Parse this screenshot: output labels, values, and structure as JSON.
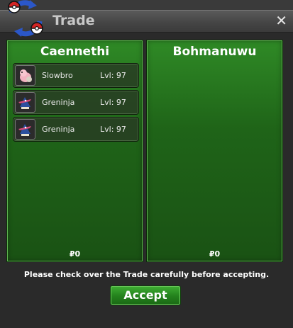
{
  "window": {
    "title": "Trade",
    "close_label": "✕"
  },
  "left_panel": {
    "trainer_name": "Caennethi",
    "pokemon": [
      {
        "name": "Slowbro",
        "level": "Lvl: 97",
        "icon": "slowbro-icon"
      },
      {
        "name": "Greninja",
        "level": "Lvl: 97",
        "icon": "greninja-icon"
      },
      {
        "name": "Greninja",
        "level": "Lvl: 97",
        "icon": "greninja-icon"
      }
    ],
    "money": "₽0"
  },
  "right_panel": {
    "trainer_name": "Bohmanuwu",
    "pokemon": [],
    "money": "₽0"
  },
  "footer": {
    "notice": "Please check over the Trade carefully before accepting.",
    "accept_label": "Accept"
  },
  "colors": {
    "panel_green": "#1f6418",
    "accept_green": "#2a8a22",
    "window_bg": "#2a2a2a"
  }
}
